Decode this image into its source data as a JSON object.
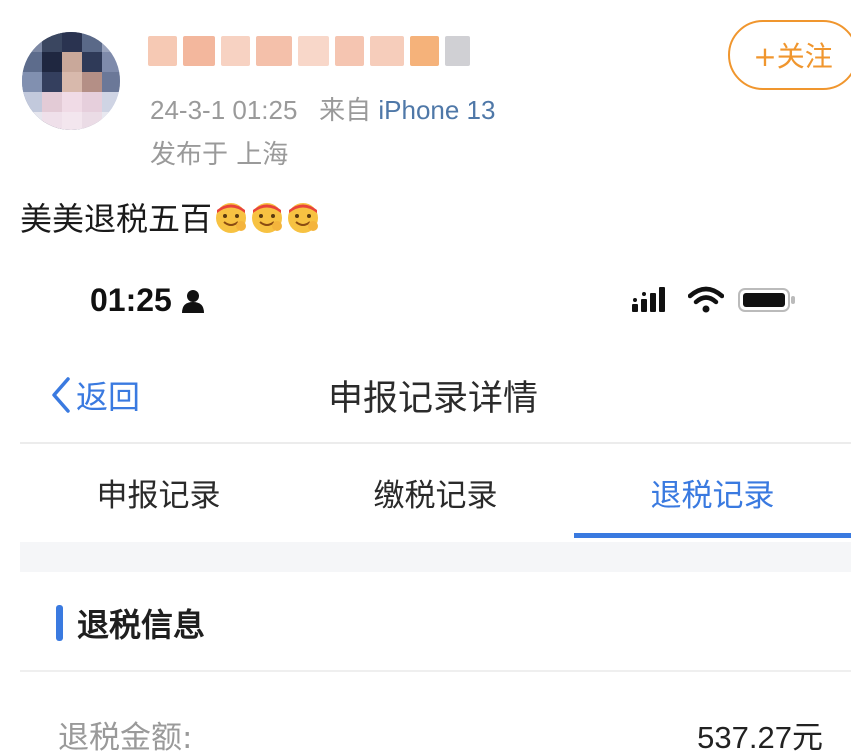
{
  "post": {
    "timestamp": "24-3-1 01:25",
    "source_prefix": "来自",
    "device": "iPhone 13",
    "location": "发布于 上海",
    "follow_label": "+关注",
    "text": "美美退税五百",
    "emoji_count": 3,
    "emoji_icon": "happy-face-emoji"
  },
  "status_bar": {
    "time": "01:25"
  },
  "nav": {
    "back_label": "返回",
    "title": "申报记录详情"
  },
  "tabs": [
    {
      "label": "申报记录",
      "active": false
    },
    {
      "label": "缴税记录",
      "active": false
    },
    {
      "label": "退税记录",
      "active": true
    }
  ],
  "section": {
    "title": "退税信息"
  },
  "refund": {
    "amount_label": "退税金额:",
    "amount_value": "537.27元"
  },
  "colors": {
    "accent": "#3a7ae0",
    "follow": "#f0962e",
    "device_link": "#4f78a8"
  }
}
